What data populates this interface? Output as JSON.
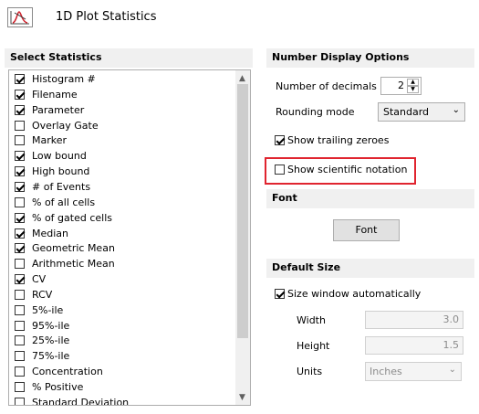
{
  "window": {
    "title": "1D Plot Statistics",
    "icon": "plot-statistics-icon"
  },
  "select_statistics": {
    "header": "Select Statistics",
    "items": [
      {
        "label": "Histogram #",
        "checked": true
      },
      {
        "label": "Filename",
        "checked": true
      },
      {
        "label": "Parameter",
        "checked": true
      },
      {
        "label": "Overlay Gate",
        "checked": false
      },
      {
        "label": "Marker",
        "checked": false
      },
      {
        "label": "Low bound",
        "checked": true
      },
      {
        "label": "High bound",
        "checked": true
      },
      {
        "label": "# of Events",
        "checked": true
      },
      {
        "label": "% of all cells",
        "checked": false
      },
      {
        "label": "% of gated cells",
        "checked": true
      },
      {
        "label": "Median",
        "checked": true
      },
      {
        "label": "Geometric Mean",
        "checked": true
      },
      {
        "label": "Arithmetic Mean",
        "checked": false
      },
      {
        "label": "CV",
        "checked": true
      },
      {
        "label": "RCV",
        "checked": false
      },
      {
        "label": "5%-ile",
        "checked": false
      },
      {
        "label": "95%-ile",
        "checked": false
      },
      {
        "label": "25%-ile",
        "checked": false
      },
      {
        "label": "75%-ile",
        "checked": false
      },
      {
        "label": "Concentration",
        "checked": false
      },
      {
        "label": "% Positive",
        "checked": false
      },
      {
        "label": "Standard Deviation",
        "checked": false
      }
    ]
  },
  "number_display": {
    "header": "Number Display Options",
    "decimals_label": "Number of decimals",
    "decimals_value": "2",
    "rounding_label": "Rounding mode",
    "rounding_value": "Standard",
    "trailing_zeroes_label": "Show trailing zeroes",
    "trailing_zeroes_checked": true,
    "scientific_label": "Show scientific notation",
    "scientific_checked": false,
    "highlight_color": "#e0242f"
  },
  "font": {
    "header": "Font",
    "button_label": "Font"
  },
  "default_size": {
    "header": "Default Size",
    "auto_size_label": "Size window automatically",
    "auto_size_checked": true,
    "width_label": "Width",
    "width_value": "3.0",
    "height_label": "Height",
    "height_value": "1.5",
    "units_label": "Units",
    "units_value": "Inches"
  }
}
